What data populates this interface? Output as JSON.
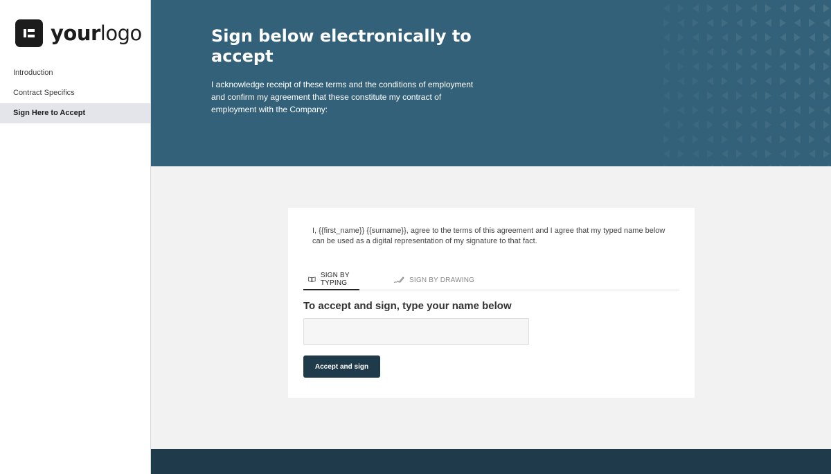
{
  "logo": {
    "text_bold": "your",
    "text_regular": "logo"
  },
  "sidebar": {
    "items": [
      {
        "label": "Introduction"
      },
      {
        "label": "Contract Specifics"
      },
      {
        "label": "Sign Here to Accept"
      }
    ]
  },
  "header": {
    "title": "Sign below electronically to accept",
    "text": "I acknowledge receipt of these terms and the conditions of employment and confirm my agreement that these constitute my contract of employment with the Company:"
  },
  "card": {
    "agreement": "I, {{first_name}} {{surname}}, agree to the terms of this agreement and I agree that my typed name below can be used as a digital representation of my signature to that fact.",
    "tabs": [
      {
        "label": "SIGN BY TYPING",
        "icon": "open-book-icon",
        "active": true
      },
      {
        "label": "SIGN BY DRAWING",
        "icon": "pen-scribble-icon",
        "active": false
      }
    ],
    "sign_heading": "To accept and sign, type your name below",
    "name_input": {
      "value": "",
      "placeholder": ""
    },
    "accept_button": "Accept and sign"
  },
  "colors": {
    "header_bg": "#336179",
    "footer_bg": "#1f3a4b",
    "button_bg": "#1f3a4b",
    "active_nav_bg": "#e3e5ea"
  }
}
